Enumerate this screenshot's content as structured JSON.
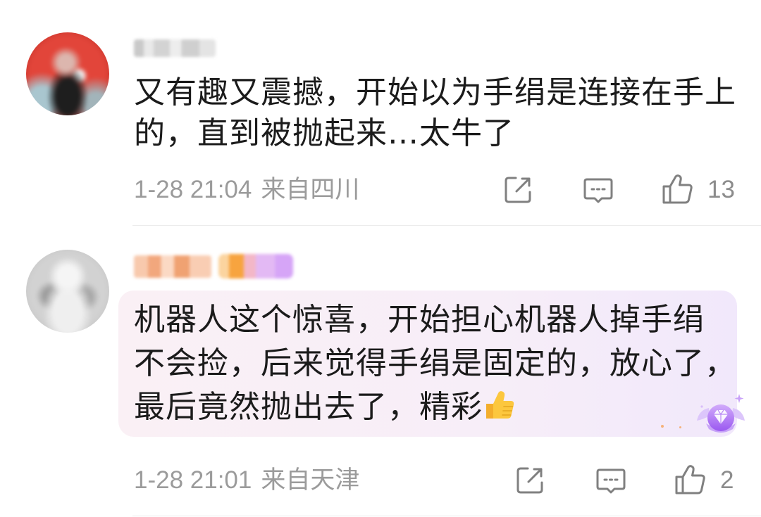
{
  "theme": {
    "text": "#1b1b1b",
    "meta": "#9b9b9b",
    "icon": "#808080",
    "divider": "#ececec",
    "highlight_start": "#faf0f5",
    "highlight_end": "#f1e8fb",
    "badge_purple": "#a567f2"
  },
  "icons": {
    "share": "share-icon",
    "comment": "comment-icon",
    "like": "thumbs-up-icon",
    "emoji": "thumbs-up-emoji",
    "badge": "purple-gem-badge"
  },
  "comments": [
    {
      "lines": [
        "又有趣又震撼，开始以为手绢是连接在手上",
        "的，直到被抛起来…太牛了"
      ],
      "time": "1-28 21:04",
      "location": "来自四川",
      "like_count": "13",
      "highlighted": false
    },
    {
      "lines": [
        "机器人这个惊喜，开始担心机器人掉手绢",
        "不会捡，后来觉得手绢是固定的，放心了，",
        "最后竟然抛出去了，精彩"
      ],
      "trailing_emoji": "thumbs-up-emoji",
      "time": "1-28 21:01",
      "location": "来自天津",
      "like_count": "2",
      "highlighted": true
    }
  ]
}
